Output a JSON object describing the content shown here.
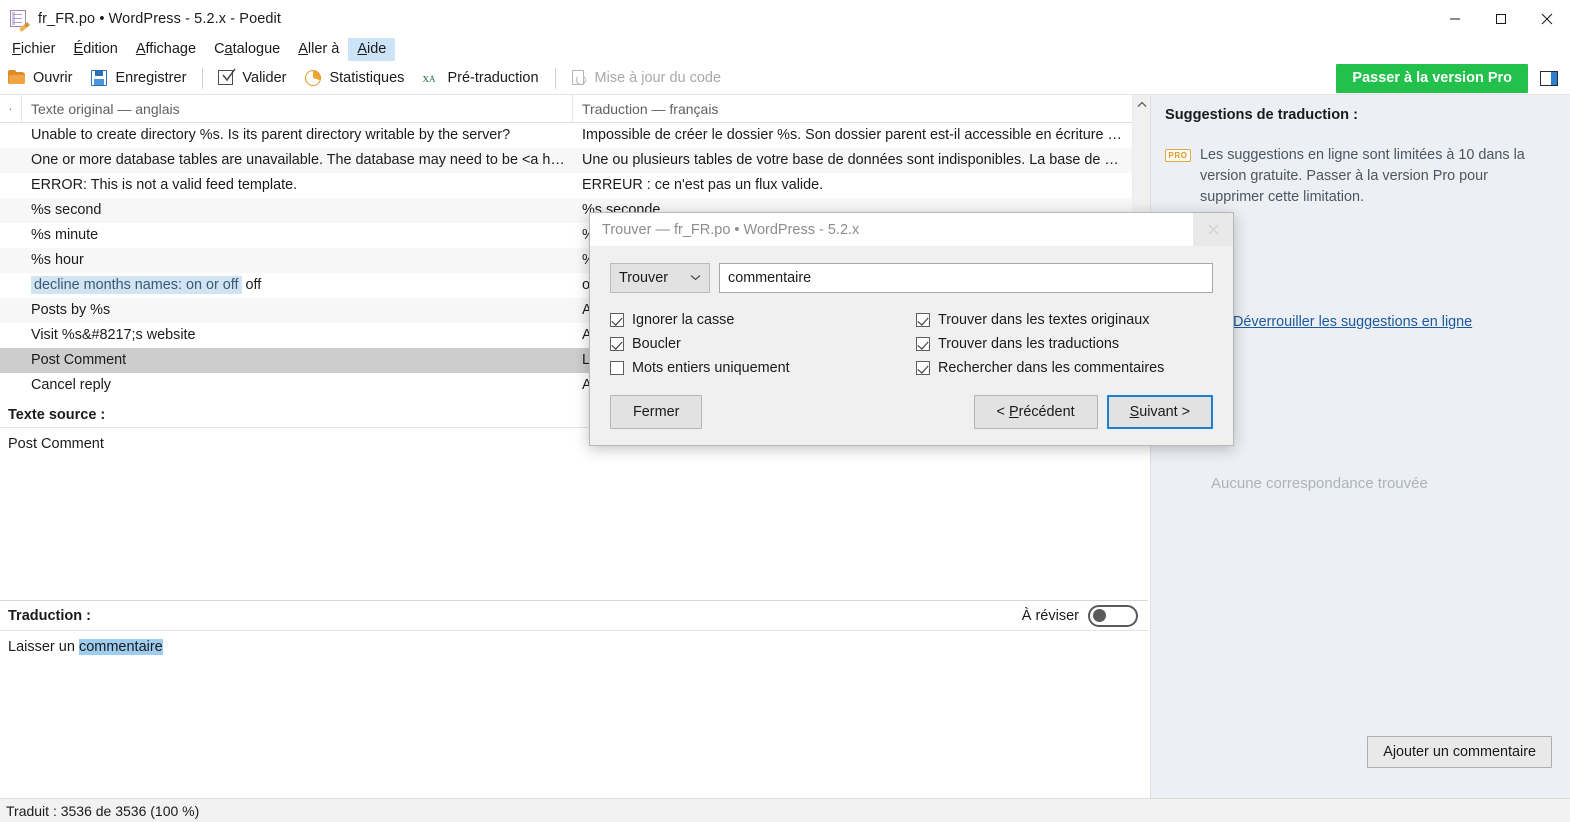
{
  "window": {
    "title": "fr_FR.po • WordPress - 5.2.x - Poedit",
    "controls": {
      "minimize": "minimize-icon",
      "maximize": "maximize-icon",
      "close": "close-icon"
    }
  },
  "menubar": {
    "items": [
      {
        "label": "Fichier",
        "mnemonic": "F",
        "active": false
      },
      {
        "label": "Édition",
        "mnemonic": "É",
        "active": false
      },
      {
        "label": "Affichage",
        "mnemonic": "A",
        "active": false
      },
      {
        "label": "Catalogue",
        "mnemonic": "a",
        "active": false
      },
      {
        "label": "Aller à",
        "mnemonic": "A",
        "active": false
      },
      {
        "label": "Aide",
        "mnemonic": "A",
        "active": true
      }
    ]
  },
  "toolbar": {
    "open": "Ouvrir",
    "save": "Enregistrer",
    "validate": "Valider",
    "stats": "Statistiques",
    "pretranslate": "Pré-traduction",
    "code_update": "Mise à jour du code",
    "pro_button": "Passer à la version Pro",
    "pro_color": "#22c14c",
    "sidebar_toggle": "sidebar-toggle-icon"
  },
  "list": {
    "header": {
      "marker": "·",
      "source": "Texte original — anglais",
      "target": "Traduction — français"
    },
    "rows": [
      {
        "source": "Unable to create directory %s. Is its parent directory writable by the server?",
        "target": "Impossible de créer le dossier %s. Son dossier parent est-il accessible en écriture …"
      },
      {
        "source": "One or more database tables are unavailable. The database may need to be <a h…",
        "target": "Une ou plusieurs tables de votre base de données sont indisponibles. La base de …"
      },
      {
        "source": "ERROR: This is not a valid feed template.",
        "target": "ERREUR : ce n'est pas un flux valide."
      },
      {
        "source": "%s second",
        "target": "%s seconde"
      },
      {
        "source": "%s minute",
        "target": "%s minute"
      },
      {
        "source": "%s hour",
        "target": "%s heure"
      },
      {
        "source": "off",
        "source_keyword": "decline months names: on or off",
        "target": "off"
      },
      {
        "source": "Posts by %s",
        "target": "Articles de %s"
      },
      {
        "source": "Visit %s&#8217;s website",
        "target": "Aller sur le site de %s"
      },
      {
        "source": "Post Comment",
        "target": "Laisser un commentaire",
        "selected": true
      },
      {
        "source": "Cancel reply",
        "target": "Annuler la réponse"
      }
    ]
  },
  "source_panel": {
    "title": "Texte source :",
    "text": "Post Comment"
  },
  "translation_panel": {
    "title": "Traduction :",
    "fuzzy_label": "À réviser",
    "fuzzy_on": false,
    "text_prefix": "Laisser un ",
    "text_highlight": "commentaire"
  },
  "sidebar": {
    "title": "Suggestions de traduction :",
    "pro_badge": "PRO",
    "pro_text": "Les suggestions en ligne sont limitées à 10 dans la version gratuite. Passer à la version Pro pour supprimer cette limitation.",
    "unlock_link": "Déverrouiller les suggestions en ligne",
    "no_results": "Aucune correspondance trouvée",
    "add_comment_button": "Ajouter un commentaire"
  },
  "statusbar": {
    "text": "Traduit : 3536 de 3536 (100 %)"
  },
  "dialog": {
    "title": "Trouver — fr_FR.po • WordPress - 5.2.x",
    "close_icon": "close-icon",
    "mode_select": "Trouver",
    "chevron": "⌄",
    "query_value": "commentaire",
    "query_placeholder": "",
    "checkboxes_left": [
      {
        "label": "Ignorer la casse",
        "checked": true
      },
      {
        "label": "Boucler",
        "checked": true
      },
      {
        "label": "Mots entiers uniquement",
        "checked": false
      }
    ],
    "checkboxes_right": [
      {
        "label": "Trouver dans les textes originaux",
        "checked": true
      },
      {
        "label": "Trouver dans les traductions",
        "checked": true
      },
      {
        "label": "Rechercher dans les commentaires",
        "checked": true
      }
    ],
    "close_button": "Fermer",
    "prev_button_pre": "< ",
    "prev_button_mnemonic": "P",
    "prev_button_post": "récédent",
    "next_button_mnemonic": "S",
    "next_button_post": "uivant >",
    "accent_color": "#1a7fcf"
  }
}
